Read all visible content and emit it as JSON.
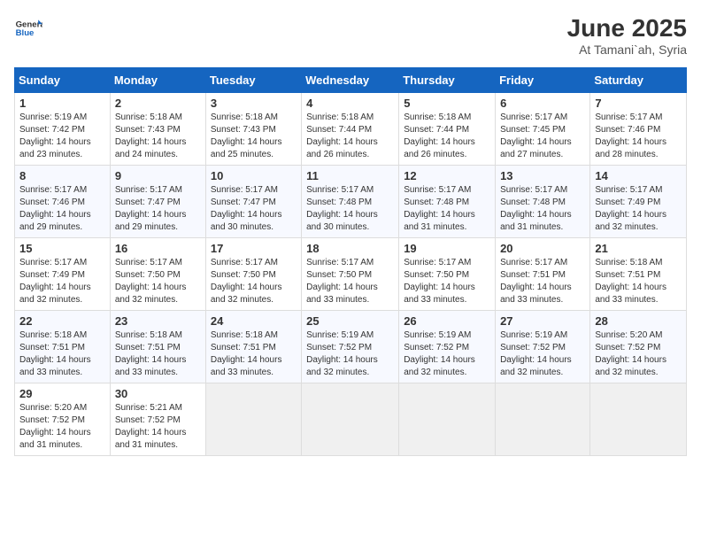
{
  "logo": {
    "general": "General",
    "blue": "Blue"
  },
  "header": {
    "month": "June 2025",
    "location": "At Tamani`ah, Syria"
  },
  "weekdays": [
    "Sunday",
    "Monday",
    "Tuesday",
    "Wednesday",
    "Thursday",
    "Friday",
    "Saturday"
  ],
  "weeks": [
    [
      {
        "day": "1",
        "sunrise": "Sunrise: 5:19 AM",
        "sunset": "Sunset: 7:42 PM",
        "daylight": "Daylight: 14 hours and 23 minutes."
      },
      {
        "day": "2",
        "sunrise": "Sunrise: 5:18 AM",
        "sunset": "Sunset: 7:43 PM",
        "daylight": "Daylight: 14 hours and 24 minutes."
      },
      {
        "day": "3",
        "sunrise": "Sunrise: 5:18 AM",
        "sunset": "Sunset: 7:43 PM",
        "daylight": "Daylight: 14 hours and 25 minutes."
      },
      {
        "day": "4",
        "sunrise": "Sunrise: 5:18 AM",
        "sunset": "Sunset: 7:44 PM",
        "daylight": "Daylight: 14 hours and 26 minutes."
      },
      {
        "day": "5",
        "sunrise": "Sunrise: 5:18 AM",
        "sunset": "Sunset: 7:44 PM",
        "daylight": "Daylight: 14 hours and 26 minutes."
      },
      {
        "day": "6",
        "sunrise": "Sunrise: 5:17 AM",
        "sunset": "Sunset: 7:45 PM",
        "daylight": "Daylight: 14 hours and 27 minutes."
      },
      {
        "day": "7",
        "sunrise": "Sunrise: 5:17 AM",
        "sunset": "Sunset: 7:46 PM",
        "daylight": "Daylight: 14 hours and 28 minutes."
      }
    ],
    [
      {
        "day": "8",
        "sunrise": "Sunrise: 5:17 AM",
        "sunset": "Sunset: 7:46 PM",
        "daylight": "Daylight: 14 hours and 29 minutes."
      },
      {
        "day": "9",
        "sunrise": "Sunrise: 5:17 AM",
        "sunset": "Sunset: 7:47 PM",
        "daylight": "Daylight: 14 hours and 29 minutes."
      },
      {
        "day": "10",
        "sunrise": "Sunrise: 5:17 AM",
        "sunset": "Sunset: 7:47 PM",
        "daylight": "Daylight: 14 hours and 30 minutes."
      },
      {
        "day": "11",
        "sunrise": "Sunrise: 5:17 AM",
        "sunset": "Sunset: 7:48 PM",
        "daylight": "Daylight: 14 hours and 30 minutes."
      },
      {
        "day": "12",
        "sunrise": "Sunrise: 5:17 AM",
        "sunset": "Sunset: 7:48 PM",
        "daylight": "Daylight: 14 hours and 31 minutes."
      },
      {
        "day": "13",
        "sunrise": "Sunrise: 5:17 AM",
        "sunset": "Sunset: 7:48 PM",
        "daylight": "Daylight: 14 hours and 31 minutes."
      },
      {
        "day": "14",
        "sunrise": "Sunrise: 5:17 AM",
        "sunset": "Sunset: 7:49 PM",
        "daylight": "Daylight: 14 hours and 32 minutes."
      }
    ],
    [
      {
        "day": "15",
        "sunrise": "Sunrise: 5:17 AM",
        "sunset": "Sunset: 7:49 PM",
        "daylight": "Daylight: 14 hours and 32 minutes."
      },
      {
        "day": "16",
        "sunrise": "Sunrise: 5:17 AM",
        "sunset": "Sunset: 7:50 PM",
        "daylight": "Daylight: 14 hours and 32 minutes."
      },
      {
        "day": "17",
        "sunrise": "Sunrise: 5:17 AM",
        "sunset": "Sunset: 7:50 PM",
        "daylight": "Daylight: 14 hours and 32 minutes."
      },
      {
        "day": "18",
        "sunrise": "Sunrise: 5:17 AM",
        "sunset": "Sunset: 7:50 PM",
        "daylight": "Daylight: 14 hours and 33 minutes."
      },
      {
        "day": "19",
        "sunrise": "Sunrise: 5:17 AM",
        "sunset": "Sunset: 7:50 PM",
        "daylight": "Daylight: 14 hours and 33 minutes."
      },
      {
        "day": "20",
        "sunrise": "Sunrise: 5:17 AM",
        "sunset": "Sunset: 7:51 PM",
        "daylight": "Daylight: 14 hours and 33 minutes."
      },
      {
        "day": "21",
        "sunrise": "Sunrise: 5:18 AM",
        "sunset": "Sunset: 7:51 PM",
        "daylight": "Daylight: 14 hours and 33 minutes."
      }
    ],
    [
      {
        "day": "22",
        "sunrise": "Sunrise: 5:18 AM",
        "sunset": "Sunset: 7:51 PM",
        "daylight": "Daylight: 14 hours and 33 minutes."
      },
      {
        "day": "23",
        "sunrise": "Sunrise: 5:18 AM",
        "sunset": "Sunset: 7:51 PM",
        "daylight": "Daylight: 14 hours and 33 minutes."
      },
      {
        "day": "24",
        "sunrise": "Sunrise: 5:18 AM",
        "sunset": "Sunset: 7:51 PM",
        "daylight": "Daylight: 14 hours and 33 minutes."
      },
      {
        "day": "25",
        "sunrise": "Sunrise: 5:19 AM",
        "sunset": "Sunset: 7:52 PM",
        "daylight": "Daylight: 14 hours and 32 minutes."
      },
      {
        "day": "26",
        "sunrise": "Sunrise: 5:19 AM",
        "sunset": "Sunset: 7:52 PM",
        "daylight": "Daylight: 14 hours and 32 minutes."
      },
      {
        "day": "27",
        "sunrise": "Sunrise: 5:19 AM",
        "sunset": "Sunset: 7:52 PM",
        "daylight": "Daylight: 14 hours and 32 minutes."
      },
      {
        "day": "28",
        "sunrise": "Sunrise: 5:20 AM",
        "sunset": "Sunset: 7:52 PM",
        "daylight": "Daylight: 14 hours and 32 minutes."
      }
    ],
    [
      {
        "day": "29",
        "sunrise": "Sunrise: 5:20 AM",
        "sunset": "Sunset: 7:52 PM",
        "daylight": "Daylight: 14 hours and 31 minutes."
      },
      {
        "day": "30",
        "sunrise": "Sunrise: 5:21 AM",
        "sunset": "Sunset: 7:52 PM",
        "daylight": "Daylight: 14 hours and 31 minutes."
      },
      null,
      null,
      null,
      null,
      null
    ]
  ]
}
